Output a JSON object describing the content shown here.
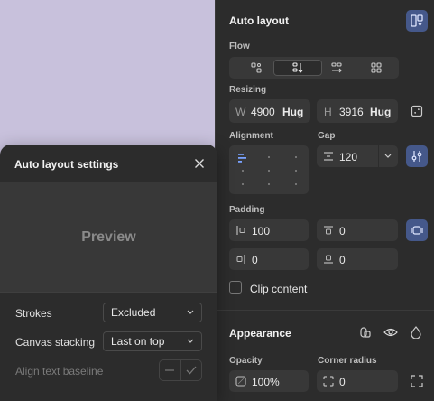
{
  "panel": {
    "auto_layout_title": "Auto layout",
    "flow_label": "Flow",
    "resizing_label": "Resizing",
    "width": {
      "prefix": "W",
      "value": "4900",
      "mode": "Hug"
    },
    "height": {
      "prefix": "H",
      "value": "3916",
      "mode": "Hug"
    },
    "alignment_label": "Alignment",
    "gap_label": "Gap",
    "gap_value": "120",
    "padding_label": "Padding",
    "padding_left": "100",
    "padding_top": "0",
    "padding_right": "0",
    "padding_bottom": "0",
    "clip_content_label": "Clip content",
    "appearance_title": "Appearance",
    "opacity_label": "Opacity",
    "opacity_value": "100%",
    "corner_radius_label": "Corner radius",
    "corner_radius_value": "0",
    "accent_color": "#45588a"
  },
  "popover": {
    "title": "Auto layout settings",
    "preview_text": "Preview",
    "strokes_label": "Strokes",
    "strokes_value": "Excluded",
    "canvas_stacking_label": "Canvas stacking",
    "canvas_stacking_value": "Last on top",
    "align_baseline_label": "Align text baseline"
  }
}
